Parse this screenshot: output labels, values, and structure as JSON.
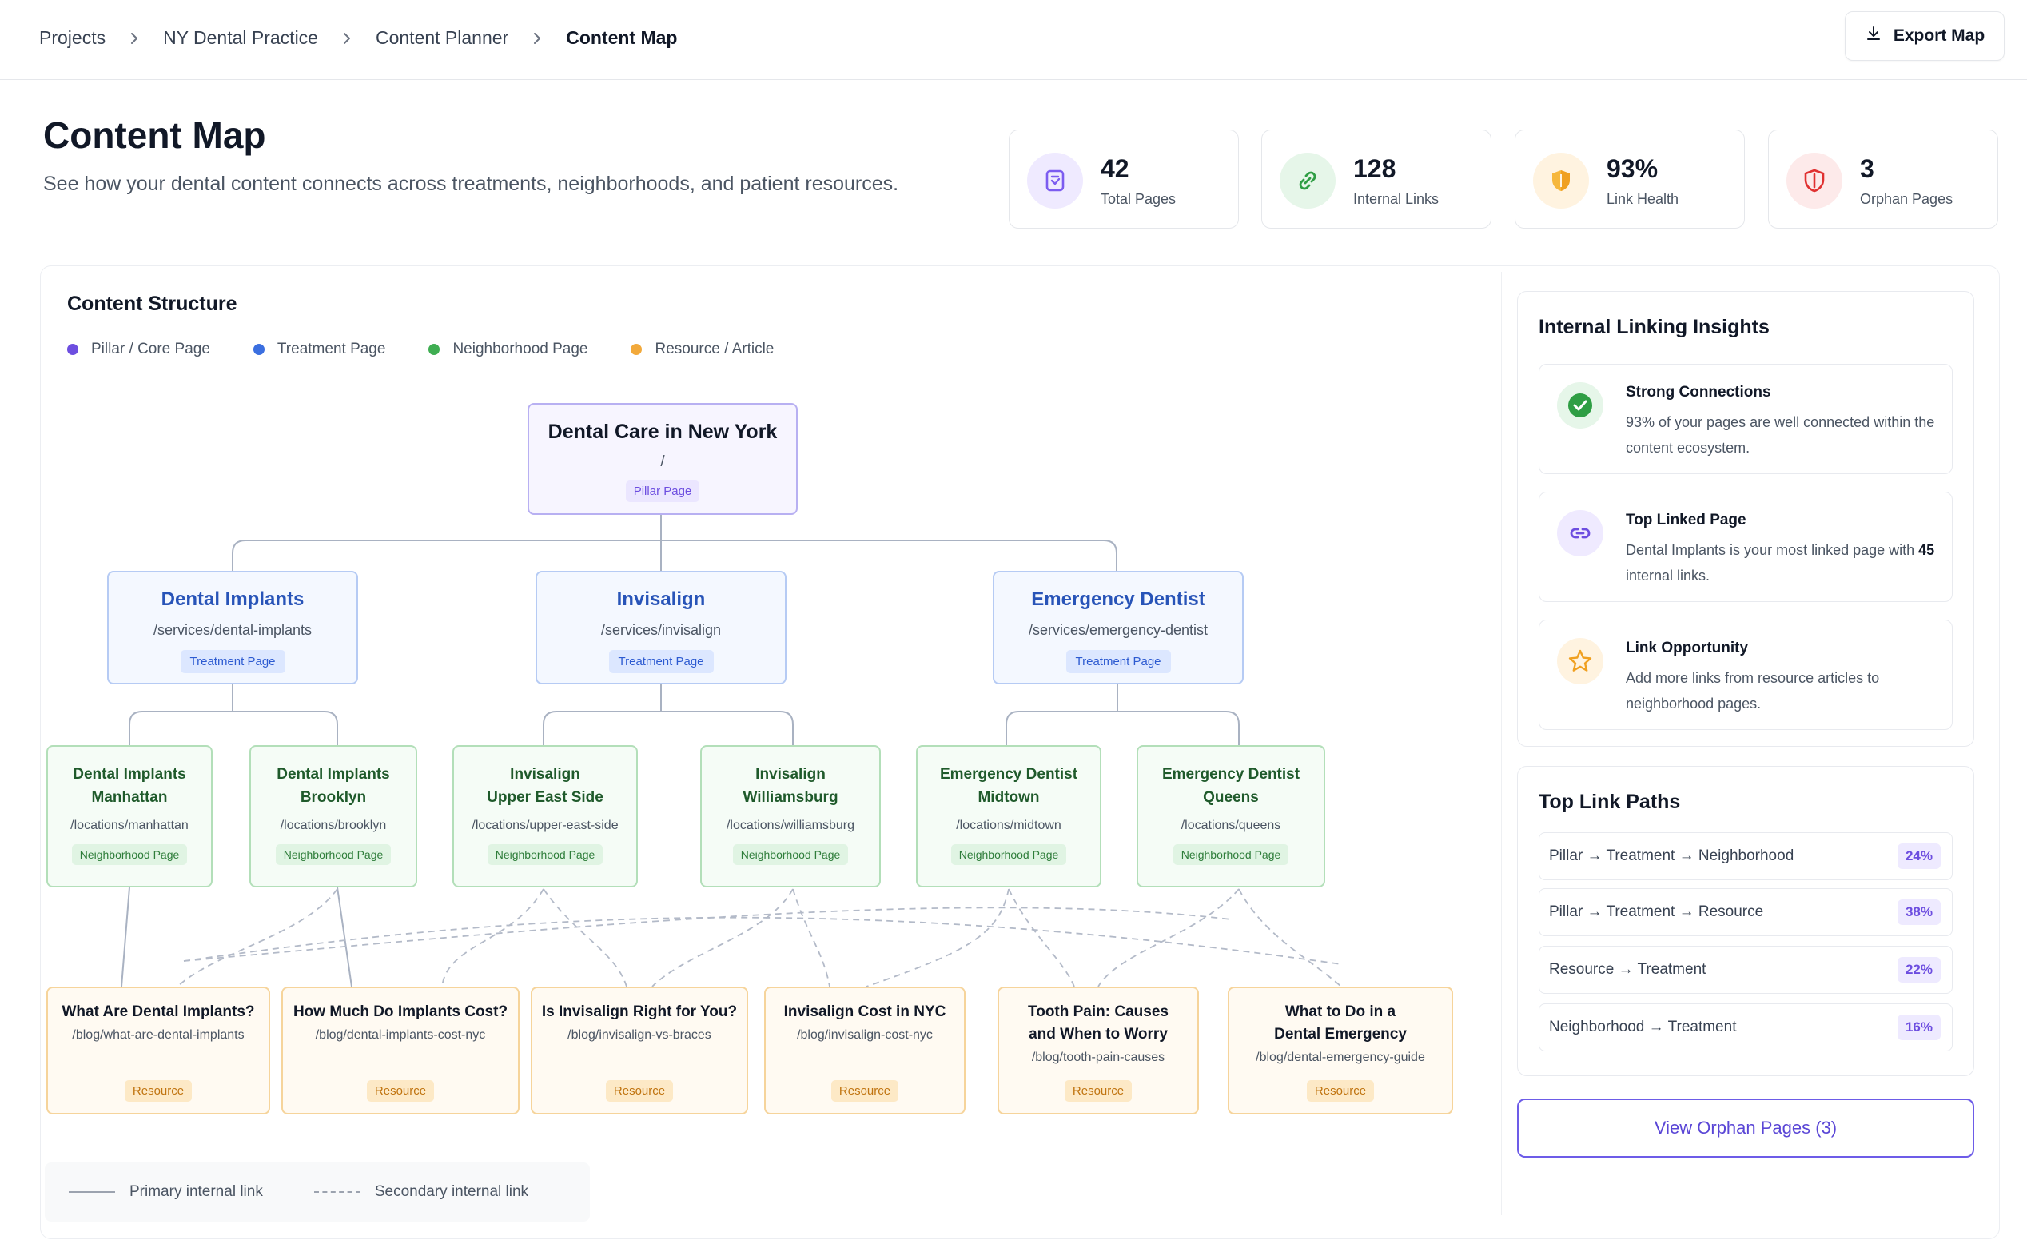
{
  "breadcrumb": {
    "items": [
      "Projects",
      "NY Dental Practice",
      "Content Planner",
      "Content Map"
    ]
  },
  "toolbar": {
    "export_label": "Export Map"
  },
  "header": {
    "title": "Content Map",
    "subtitle": "See how your dental content connects across treatments, neighborhoods, and patient resources."
  },
  "stats": [
    {
      "value": "42",
      "label": "Total Pages",
      "icon": "page-icon",
      "color": "#7c5cf0",
      "bg": "#efeaff"
    },
    {
      "value": "128",
      "label": "Internal Links",
      "icon": "link-icon",
      "color": "#2f9e44",
      "bg": "#e6f6e9"
    },
    {
      "value": "93%",
      "label": "Link Health",
      "icon": "shield-icon",
      "color": "#f0a020",
      "bg": "#fff3e0"
    },
    {
      "value": "3",
      "label": "Orphan Pages",
      "icon": "shield-alert-icon",
      "color": "#e03131",
      "bg": "#fdeaea"
    }
  ],
  "structure": {
    "title": "Content Structure",
    "legend": [
      {
        "label": "Pillar / Core Page",
        "color": "#6d4ee0"
      },
      {
        "label": "Treatment Page",
        "color": "#3b6fe0"
      },
      {
        "label": "Neighborhood Page",
        "color": "#3fae52"
      },
      {
        "label": "Resource / Article",
        "color": "#f2a93b"
      }
    ],
    "pillar": {
      "title": "Dental Care in New York",
      "path": "/",
      "badge": "Pillar Page"
    },
    "treatments": [
      {
        "title": "Dental Implants",
        "path": "/services/dental-implants",
        "badge": "Treatment Page"
      },
      {
        "title": "Invisalign",
        "path": "/services/invisalign",
        "badge": "Treatment Page"
      },
      {
        "title": "Emergency Dentist",
        "path": "/services/emergency-dentist",
        "badge": "Treatment Page"
      }
    ],
    "neighborhoods": [
      {
        "title1": "Dental Implants",
        "title2": "Manhattan",
        "path": "/locations/manhattan",
        "badge": "Neighborhood Page"
      },
      {
        "title1": "Dental Implants",
        "title2": "Brooklyn",
        "path": "/locations/brooklyn",
        "badge": "Neighborhood Page"
      },
      {
        "title1": "Invisalign",
        "title2": "Upper East Side",
        "path": "/locations/upper-east-side",
        "badge": "Neighborhood Page"
      },
      {
        "title1": "Invisalign",
        "title2": "Williamsburg",
        "path": "/locations/williamsburg",
        "badge": "Neighborhood Page"
      },
      {
        "title1": "Emergency Dentist",
        "title2": "Midtown",
        "path": "/locations/midtown",
        "badge": "Neighborhood Page"
      },
      {
        "title1": "Emergency Dentist",
        "title2": "Queens",
        "path": "/locations/queens",
        "badge": "Neighborhood Page"
      }
    ],
    "resources": [
      {
        "title1": "What Are Dental Implants?",
        "title2": "",
        "path": "/blog/what-are-dental-implants",
        "badge": "Resource"
      },
      {
        "title1": "How Much Do Implants Cost?",
        "title2": "",
        "path": "/blog/dental-implants-cost-nyc",
        "badge": "Resource"
      },
      {
        "title1": "Is Invisalign Right for You?",
        "title2": "",
        "path": "/blog/invisalign-vs-braces",
        "badge": "Resource"
      },
      {
        "title1": "Invisalign Cost in NYC",
        "title2": "",
        "path": "/blog/invisalign-cost-nyc",
        "badge": "Resource"
      },
      {
        "title1": "Tooth Pain: Causes",
        "title2": "and When to Worry",
        "path": "/blog/tooth-pain-causes",
        "badge": "Resource"
      },
      {
        "title1": "What to Do in a",
        "title2": "Dental Emergency",
        "path": "/blog/dental-emergency-guide",
        "badge": "Resource"
      }
    ],
    "line_legend": {
      "primary": "Primary internal link",
      "secondary": "Secondary internal link"
    }
  },
  "insights": {
    "title": "Internal Linking Insights",
    "items": [
      {
        "title": "Strong Connections",
        "desc": "93% of your pages are well connected within the content ecosystem.",
        "icon": "check-circle-icon"
      },
      {
        "title": "Top Linked Page",
        "desc_prefix": "Dental Implants is your most linked page with ",
        "desc_bold": "45",
        "desc_suffix": " internal links.",
        "icon": "link-icon"
      },
      {
        "title": "Link Opportunity",
        "desc": "Add more links from resource articles to neighborhood pages.",
        "icon": "star-icon"
      }
    ]
  },
  "top_paths": {
    "title": "Top Link Paths",
    "rows": [
      {
        "path": "Pillar → Treatment → Neighborhood",
        "pct": "24%"
      },
      {
        "path": "Pillar → Treatment → Resource",
        "pct": "38%"
      },
      {
        "path": "Resource → Treatment",
        "pct": "22%"
      },
      {
        "path": "Neighborhood → Treatment",
        "pct": "16%"
      }
    ]
  },
  "orphan_button": {
    "label": "View Orphan Pages (3)"
  }
}
